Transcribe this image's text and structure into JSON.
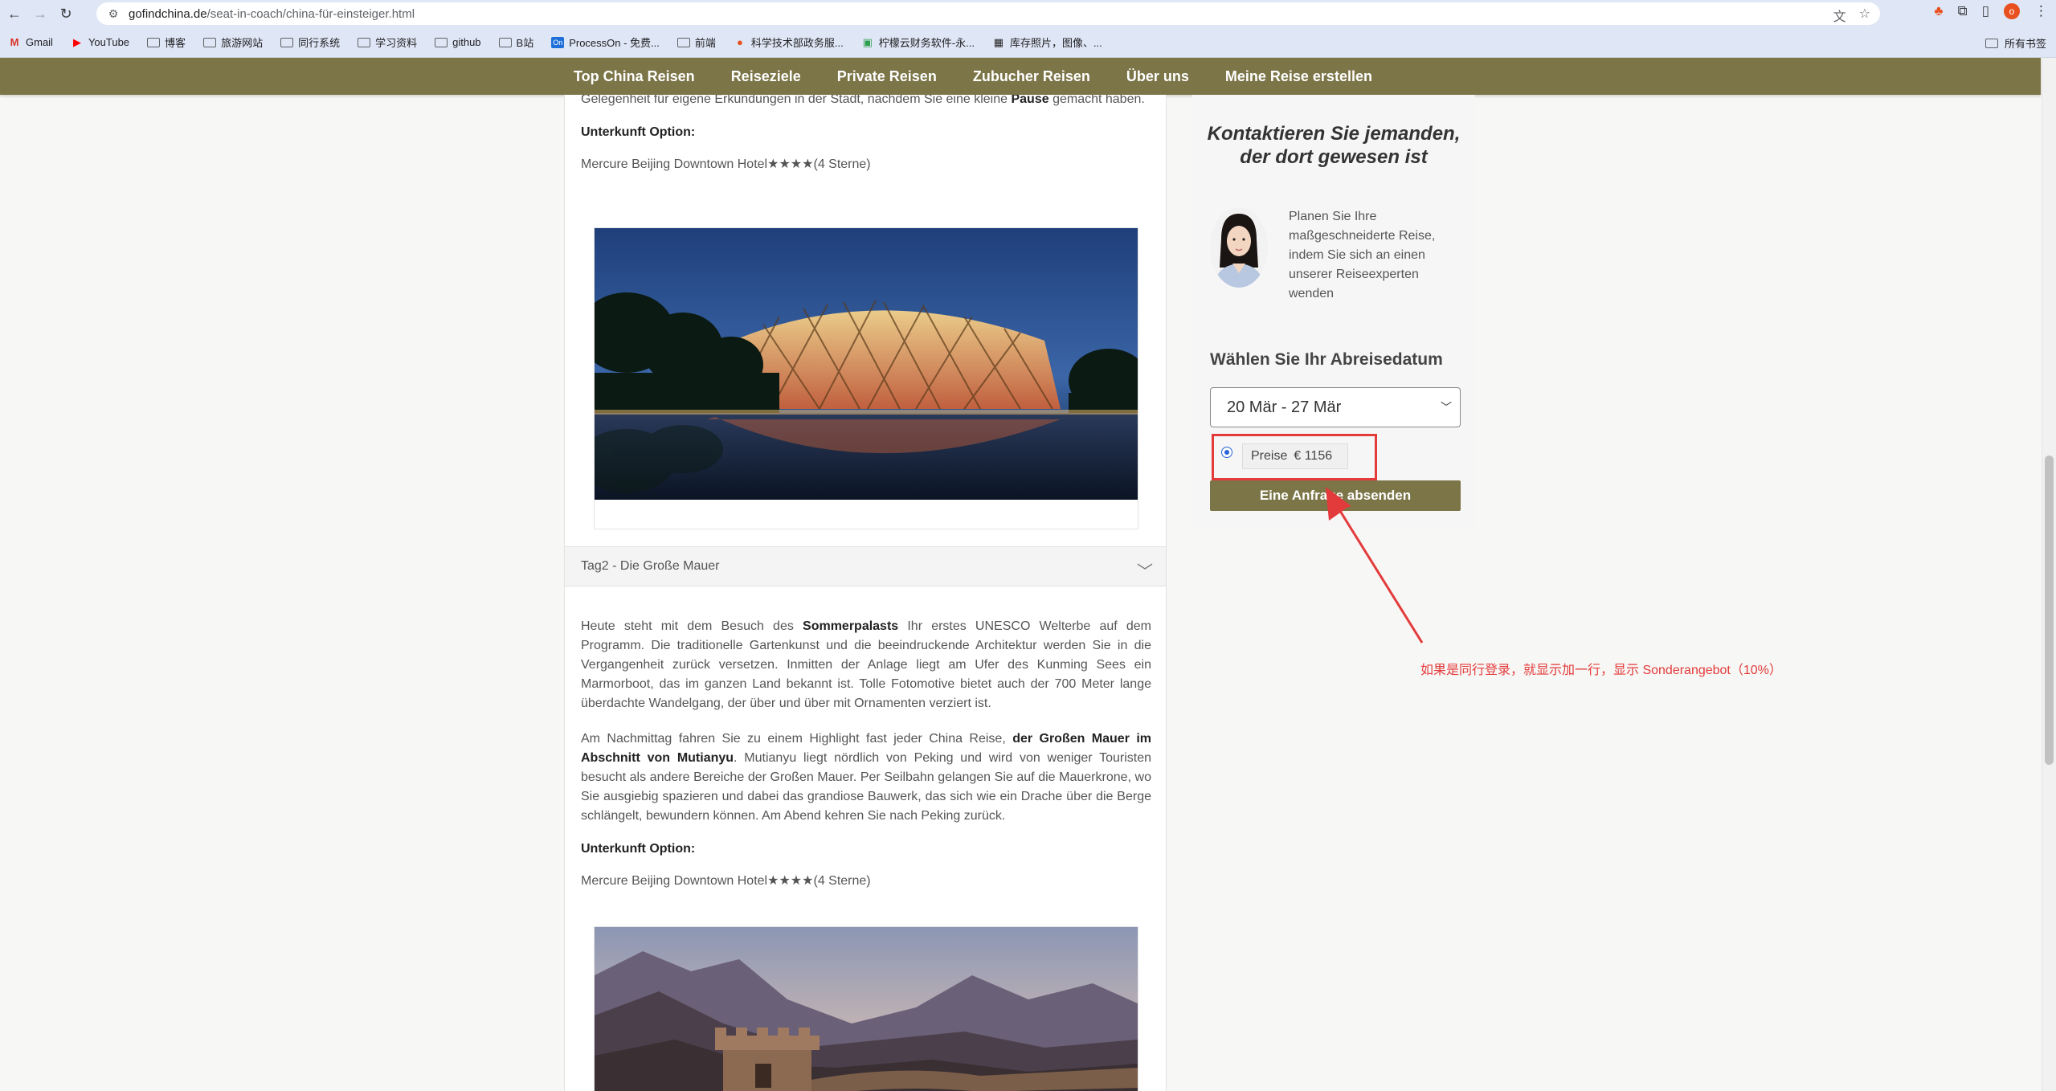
{
  "browser": {
    "url_domain": "gofindchina.de",
    "url_path": "/seat-in-coach/china-für-einsteiger.html",
    "profile_letter": "o",
    "bookmarks": [
      {
        "label": "Gmail",
        "icon": "gmail-icon"
      },
      {
        "label": "YouTube",
        "icon": "youtube-icon"
      },
      {
        "label": "博客",
        "icon": "folder-icon"
      },
      {
        "label": "旅游网站",
        "icon": "folder-icon"
      },
      {
        "label": "同行系统",
        "icon": "folder-icon"
      },
      {
        "label": "学习资料",
        "icon": "folder-icon"
      },
      {
        "label": "github",
        "icon": "folder-icon"
      },
      {
        "label": "B站",
        "icon": "folder-icon"
      },
      {
        "label": "ProcessOn - 免费...",
        "icon": "processon-icon"
      },
      {
        "label": "前端",
        "icon": "folder-icon"
      },
      {
        "label": "科学技术部政务服...",
        "icon": "gov-icon"
      },
      {
        "label": "柠檬云财务软件-永...",
        "icon": "lemon-icon"
      },
      {
        "label": "库存照片，图像、...",
        "icon": "stock-icon"
      }
    ],
    "all_bookmarks": "所有书签"
  },
  "nav": {
    "items": [
      "Top China Reisen",
      "Reiseziele",
      "Private Reisen",
      "Zubucher Reisen",
      "Über uns",
      "Meine Reise erstellen"
    ]
  },
  "content": {
    "intro_pre": "Gelegenheit für eigene Erkundungen in der Stadt, nachdem Sie eine kleine ",
    "intro_bold": "Pause",
    "intro_post": " gemacht haben.",
    "accommodation_label": "Unterkunft Option:",
    "hotel1": "Mercure Beijing Downtown Hotel",
    "stars": "★★★★",
    "stars_text": "(4 Sterne)",
    "day2_header": "Tag2 - Die Große Mauer",
    "day2_p1_pre": "Heute steht mit dem Besuch des ",
    "day2_p1_bold": "Sommerpalasts",
    "day2_p1_post": " Ihr erstes UNESCO Welterbe auf dem Programm. Die traditionelle Gartenkunst und die beeindruckende Architektur werden Sie in die Vergangenheit zurück versetzen. Inmitten der Anlage liegt am Ufer des Kunming Sees ein Marmorboot, das im ganzen Land bekannt ist. Tolle Fotomotive bietet auch der 700 Meter lange überdachte Wandelgang, der über und über mit Ornamenten verziert ist.",
    "day2_p2_pre": "Am Nachmittag fahren Sie zu einem Highlight fast jeder China Reise, ",
    "day2_p2_bold": "der Großen Mauer im Abschnitt von  Mutianyu",
    "day2_p2_post": ". Mutianyu liegt nördlich von Peking und wird von weniger Touristen besucht als andere Bereiche der Großen Mauer. Per Seilbahn gelangen Sie auf die Mauerkrone, wo Sie ausgiebig spazieren und dabei das grandiose Bauwerk, das sich wie ein Drache über die Berge schlängelt, bewundern können. Am Abend kehren Sie nach Peking zurück.",
    "accommodation_label2": "Unterkunft Option:",
    "hotel2": "Mercure Beijing Downtown Hotel",
    "stars2": "★★★★",
    "stars_text2": "(4 Sterne)"
  },
  "sidebar": {
    "title": "Kontaktieren Sie jemanden, der dort gewesen ist",
    "text": "Planen Sie Ihre maßgeschneiderte Reise, indem Sie sich an einen unserer Reiseexperten wenden",
    "date_label": "Wählen Sie Ihr Abreisedatum",
    "date_selected": "20 Mär - 27 Mär",
    "price_label": "Preise",
    "price_value": "€ 1156",
    "submit_label": "Eine Anfrage absenden"
  },
  "annotation": {
    "text": "如果是同行登录，就显示加一行，显示 Sonderangebot（10%）"
  },
  "colors": {
    "brand": "#7c7548",
    "annotation": "#e33b3b"
  }
}
